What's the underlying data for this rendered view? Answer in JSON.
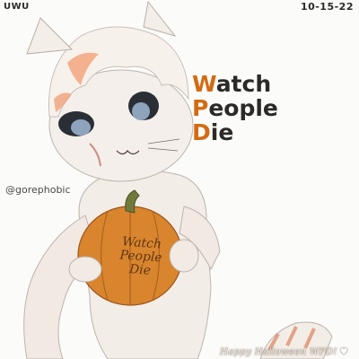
{
  "corner": {
    "top_left": "UWU",
    "top_right": "10-15-22"
  },
  "title": {
    "lines": [
      {
        "first": "W",
        "rest": "atch"
      },
      {
        "first": "P",
        "rest": "eople"
      },
      {
        "first": "D",
        "rest": "ie"
      }
    ]
  },
  "credit": "@gorephobic",
  "pumpkin_text": [
    "Watch",
    "People",
    "Die"
  ],
  "footer": {
    "text": "Happy Halloween WPD!",
    "heart": "♥"
  },
  "colors": {
    "accent": "#d36b12",
    "text": "#2c2a28",
    "pumpkin": "#d9852e",
    "fur": "#f2ece6",
    "fur_orange": "#f0a27a"
  }
}
